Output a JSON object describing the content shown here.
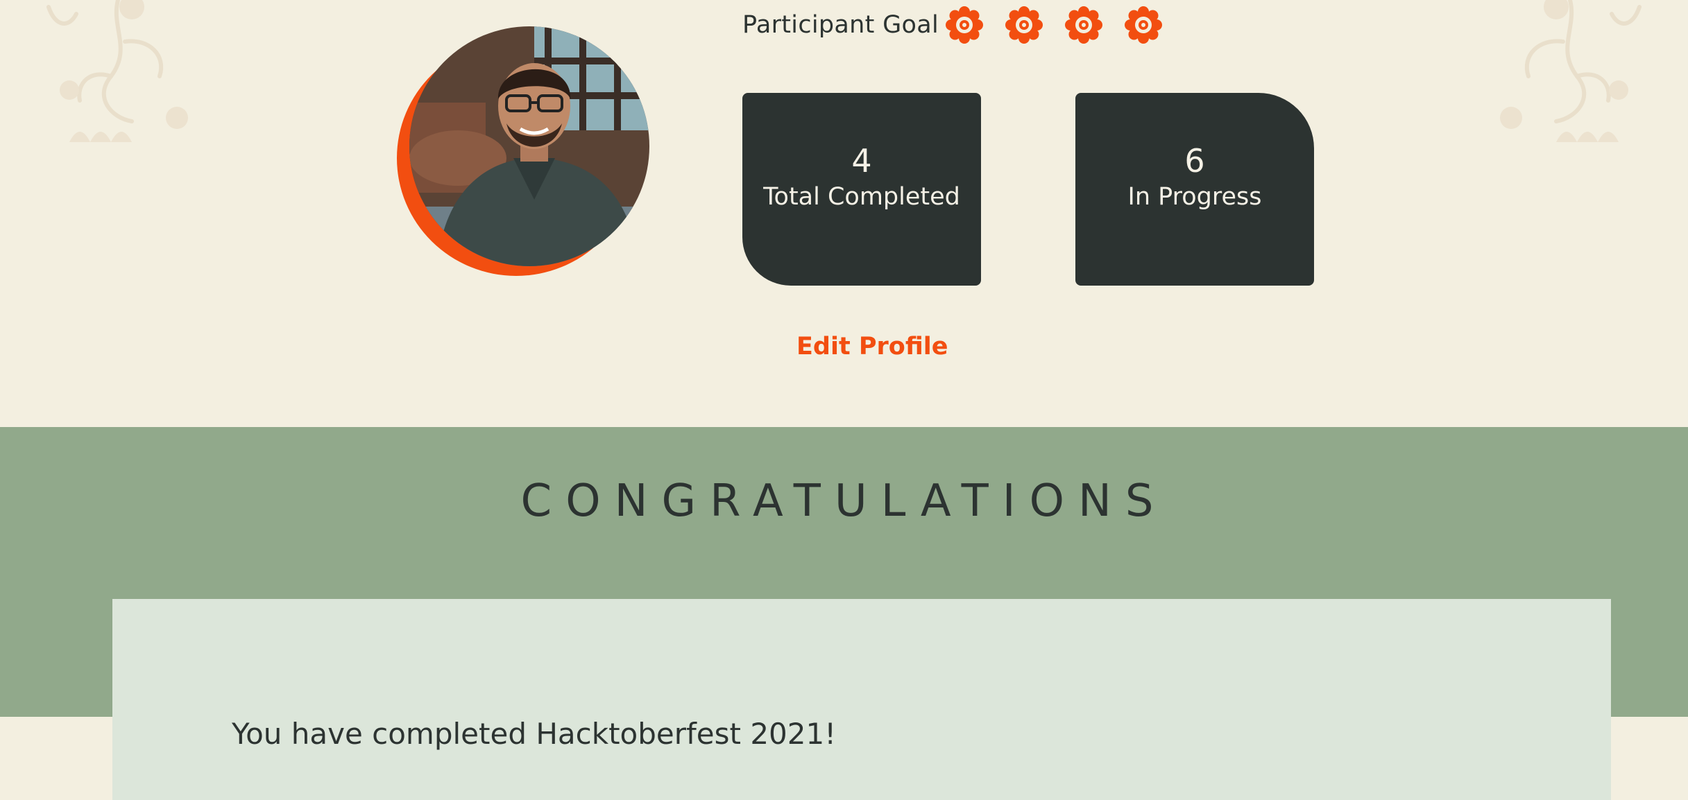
{
  "profile": {
    "goal_label": "Participant Goal",
    "badges": [
      "flower-badge-icon",
      "flower-badge-icon",
      "flower-badge-icon",
      "flower-badge-icon"
    ],
    "stats": {
      "completed_value": "4",
      "completed_label": "Total Completed",
      "progress_value": "6",
      "progress_label": "In Progress"
    },
    "edit_label": "Edit Profile",
    "avatar": "user-photo"
  },
  "congrats": {
    "title": "CONGRATULATIONS",
    "message": "You have completed Hacktoberfest 2021!"
  },
  "colors": {
    "accent": "#f24e10",
    "dark": "#2c3331",
    "background": "#f3efe0",
    "band": "#91a98b",
    "card": "#dce6da"
  }
}
